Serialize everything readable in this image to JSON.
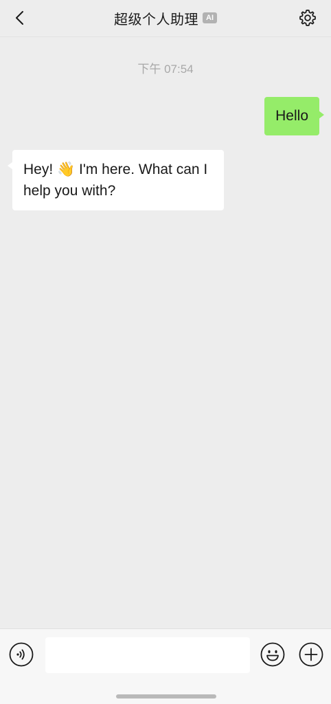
{
  "header": {
    "back_icon": "chevron-left-icon",
    "title": "超级个人助理",
    "badge": "AI",
    "settings_icon": "gear-icon"
  },
  "chat": {
    "timestamp": "下午 07:54",
    "messages": [
      {
        "role": "user",
        "text": "Hello"
      },
      {
        "role": "assistant",
        "text": "Hey! 👋 I'm here. What can I help you with?"
      }
    ]
  },
  "input_bar": {
    "voice_icon": "voice-icon",
    "input_value": "",
    "emoji_icon": "emoji-icon",
    "plus_icon": "plus-circle-icon"
  },
  "colors": {
    "background": "#ededed",
    "outgoing_bubble": "#95ec69",
    "incoming_bubble": "#ffffff",
    "timestamp": "#a8a8a8",
    "badge": "#b2b2b2"
  }
}
